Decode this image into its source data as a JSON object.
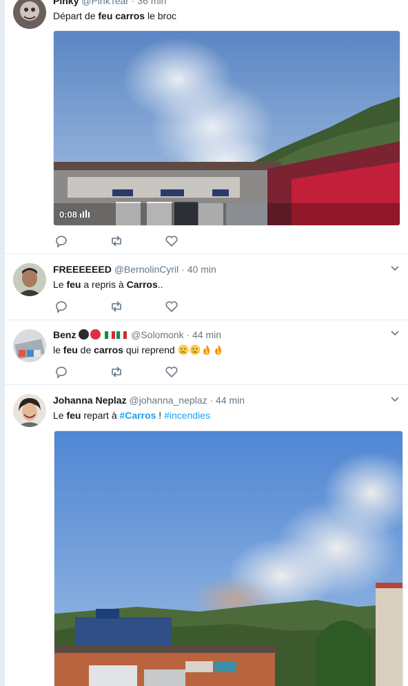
{
  "tweets": [
    {
      "name": "Pinky",
      "handle": "@PinkTear",
      "time": "36 min",
      "text_parts": [
        "Départ de ",
        "feu carros",
        " le broc"
      ],
      "video_duration": "0:08"
    },
    {
      "name": "FREEEEEED",
      "handle": "@BernolinCyril",
      "time": "40 min",
      "text_parts": [
        "Le ",
        "feu",
        " a repris à ",
        "Carros",
        ".."
      ]
    },
    {
      "name": "Benz",
      "handle": "@Solomonk",
      "time": "44 min",
      "text_parts": [
        "le ",
        "feu",
        " de ",
        "carros",
        " qui reprend "
      ],
      "emojis": [
        "crying-face",
        "crying-face",
        "fire",
        "fire"
      ]
    },
    {
      "name": "Johanna Neplaz",
      "handle": "@johanna_neplaz",
      "time": "44 min",
      "text_parts": [
        "Le ",
        "feu",
        " repart à ",
        "#Carros",
        " ! ",
        "#incendies"
      ]
    }
  ],
  "separator": "·",
  "colors": {
    "link": "#1da1f2",
    "secondary": "#657786",
    "border": "#e6ecf0"
  },
  "icons": {
    "reply": "reply-icon",
    "retweet": "retweet-icon",
    "like": "heart-icon",
    "more": "chevron-down-icon",
    "volume": "volume-icon"
  }
}
